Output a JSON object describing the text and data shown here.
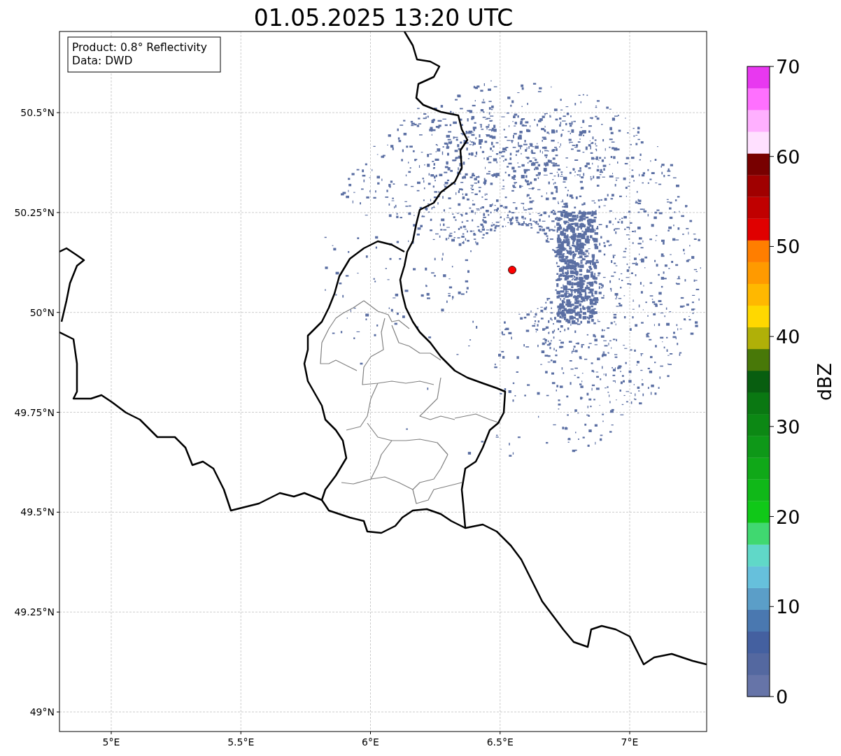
{
  "title": "01.05.2025 13:20 UTC",
  "info_box": {
    "lines": [
      "Product: 0.8° Reflectivity",
      "Data: DWD"
    ]
  },
  "map": {
    "xticks": [
      "5°E",
      "5.5°E",
      "6°E",
      "6.5°E",
      "7°E"
    ],
    "yticks": [
      "50.5°N",
      "50.25°N",
      "50°N",
      "49.75°N",
      "49.5°N",
      "49.25°N",
      "49°N"
    ]
  },
  "colorbar": {
    "label": "dBZ",
    "ticks": [
      "70",
      "60",
      "50",
      "40",
      "30",
      "20",
      "10",
      "0"
    ],
    "bins": [
      {
        "color": "#6674a8"
      },
      {
        "color": "#5468a0"
      },
      {
        "color": "#4460a0"
      },
      {
        "color": "#4a78b0"
      },
      {
        "color": "#5b9ec8"
      },
      {
        "color": "#66c0dc"
      },
      {
        "color": "#60d8c8"
      },
      {
        "color": "#40d870"
      },
      {
        "color": "#10c818"
      },
      {
        "color": "#10b818"
      },
      {
        "color": "#10a818"
      },
      {
        "color": "#0e9818"
      },
      {
        "color": "#0c8814"
      },
      {
        "color": "#0a7812"
      },
      {
        "color": "#085e10"
      },
      {
        "color": "#487808"
      },
      {
        "color": "#b0b008"
      },
      {
        "color": "#ffd800"
      },
      {
        "color": "#ffb800"
      },
      {
        "color": "#ff9a00"
      },
      {
        "color": "#ff7e00"
      },
      {
        "color": "#e00000"
      },
      {
        "color": "#c00000"
      },
      {
        "color": "#a00000"
      },
      {
        "color": "#780000"
      },
      {
        "color": "#ffe0ff"
      },
      {
        "color": "#ffb0ff"
      },
      {
        "color": "#ff70ff"
      },
      {
        "color": "#e838f0"
      }
    ]
  }
}
